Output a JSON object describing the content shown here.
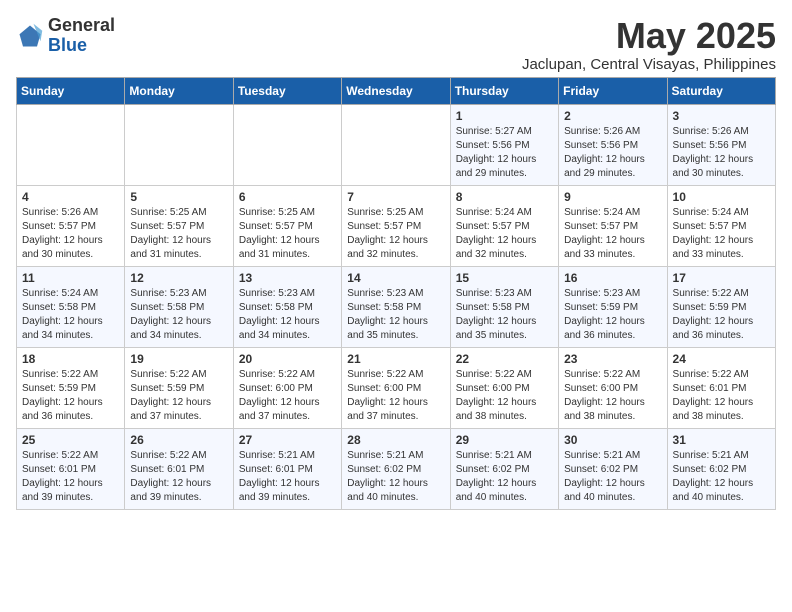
{
  "logo": {
    "general": "General",
    "blue": "Blue"
  },
  "title": "May 2025",
  "location": "Jaclupan, Central Visayas, Philippines",
  "headers": [
    "Sunday",
    "Monday",
    "Tuesday",
    "Wednesday",
    "Thursday",
    "Friday",
    "Saturday"
  ],
  "weeks": [
    [
      {
        "day": "",
        "info": ""
      },
      {
        "day": "",
        "info": ""
      },
      {
        "day": "",
        "info": ""
      },
      {
        "day": "",
        "info": ""
      },
      {
        "day": "1",
        "info": "Sunrise: 5:27 AM\nSunset: 5:56 PM\nDaylight: 12 hours and 29 minutes."
      },
      {
        "day": "2",
        "info": "Sunrise: 5:26 AM\nSunset: 5:56 PM\nDaylight: 12 hours and 29 minutes."
      },
      {
        "day": "3",
        "info": "Sunrise: 5:26 AM\nSunset: 5:56 PM\nDaylight: 12 hours and 30 minutes."
      }
    ],
    [
      {
        "day": "4",
        "info": "Sunrise: 5:26 AM\nSunset: 5:57 PM\nDaylight: 12 hours and 30 minutes."
      },
      {
        "day": "5",
        "info": "Sunrise: 5:25 AM\nSunset: 5:57 PM\nDaylight: 12 hours and 31 minutes."
      },
      {
        "day": "6",
        "info": "Sunrise: 5:25 AM\nSunset: 5:57 PM\nDaylight: 12 hours and 31 minutes."
      },
      {
        "day": "7",
        "info": "Sunrise: 5:25 AM\nSunset: 5:57 PM\nDaylight: 12 hours and 32 minutes."
      },
      {
        "day": "8",
        "info": "Sunrise: 5:24 AM\nSunset: 5:57 PM\nDaylight: 12 hours and 32 minutes."
      },
      {
        "day": "9",
        "info": "Sunrise: 5:24 AM\nSunset: 5:57 PM\nDaylight: 12 hours and 33 minutes."
      },
      {
        "day": "10",
        "info": "Sunrise: 5:24 AM\nSunset: 5:57 PM\nDaylight: 12 hours and 33 minutes."
      }
    ],
    [
      {
        "day": "11",
        "info": "Sunrise: 5:24 AM\nSunset: 5:58 PM\nDaylight: 12 hours and 34 minutes."
      },
      {
        "day": "12",
        "info": "Sunrise: 5:23 AM\nSunset: 5:58 PM\nDaylight: 12 hours and 34 minutes."
      },
      {
        "day": "13",
        "info": "Sunrise: 5:23 AM\nSunset: 5:58 PM\nDaylight: 12 hours and 34 minutes."
      },
      {
        "day": "14",
        "info": "Sunrise: 5:23 AM\nSunset: 5:58 PM\nDaylight: 12 hours and 35 minutes."
      },
      {
        "day": "15",
        "info": "Sunrise: 5:23 AM\nSunset: 5:58 PM\nDaylight: 12 hours and 35 minutes."
      },
      {
        "day": "16",
        "info": "Sunrise: 5:23 AM\nSunset: 5:59 PM\nDaylight: 12 hours and 36 minutes."
      },
      {
        "day": "17",
        "info": "Sunrise: 5:22 AM\nSunset: 5:59 PM\nDaylight: 12 hours and 36 minutes."
      }
    ],
    [
      {
        "day": "18",
        "info": "Sunrise: 5:22 AM\nSunset: 5:59 PM\nDaylight: 12 hours and 36 minutes."
      },
      {
        "day": "19",
        "info": "Sunrise: 5:22 AM\nSunset: 5:59 PM\nDaylight: 12 hours and 37 minutes."
      },
      {
        "day": "20",
        "info": "Sunrise: 5:22 AM\nSunset: 6:00 PM\nDaylight: 12 hours and 37 minutes."
      },
      {
        "day": "21",
        "info": "Sunrise: 5:22 AM\nSunset: 6:00 PM\nDaylight: 12 hours and 37 minutes."
      },
      {
        "day": "22",
        "info": "Sunrise: 5:22 AM\nSunset: 6:00 PM\nDaylight: 12 hours and 38 minutes."
      },
      {
        "day": "23",
        "info": "Sunrise: 5:22 AM\nSunset: 6:00 PM\nDaylight: 12 hours and 38 minutes."
      },
      {
        "day": "24",
        "info": "Sunrise: 5:22 AM\nSunset: 6:01 PM\nDaylight: 12 hours and 38 minutes."
      }
    ],
    [
      {
        "day": "25",
        "info": "Sunrise: 5:22 AM\nSunset: 6:01 PM\nDaylight: 12 hours and 39 minutes."
      },
      {
        "day": "26",
        "info": "Sunrise: 5:22 AM\nSunset: 6:01 PM\nDaylight: 12 hours and 39 minutes."
      },
      {
        "day": "27",
        "info": "Sunrise: 5:21 AM\nSunset: 6:01 PM\nDaylight: 12 hours and 39 minutes."
      },
      {
        "day": "28",
        "info": "Sunrise: 5:21 AM\nSunset: 6:02 PM\nDaylight: 12 hours and 40 minutes."
      },
      {
        "day": "29",
        "info": "Sunrise: 5:21 AM\nSunset: 6:02 PM\nDaylight: 12 hours and 40 minutes."
      },
      {
        "day": "30",
        "info": "Sunrise: 5:21 AM\nSunset: 6:02 PM\nDaylight: 12 hours and 40 minutes."
      },
      {
        "day": "31",
        "info": "Sunrise: 5:21 AM\nSunset: 6:02 PM\nDaylight: 12 hours and 40 minutes."
      }
    ]
  ]
}
